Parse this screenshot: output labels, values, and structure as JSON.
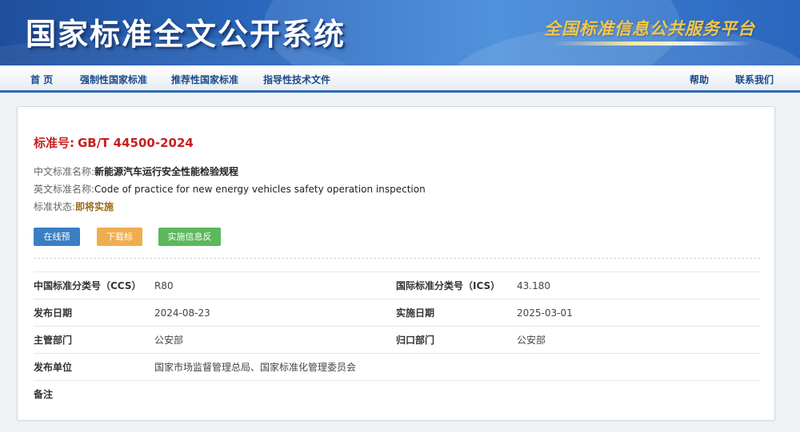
{
  "header": {
    "title": "国家标准全文公开系统",
    "slogan": "全国标准信息公共服务平台"
  },
  "nav": {
    "home": "首 页",
    "mandatory": "强制性国家标准",
    "recommended": "推荐性国家标准",
    "guidance": "指导性技术文件",
    "help": "帮助",
    "contact": "联系我们"
  },
  "standard": {
    "number_label": "标准号:",
    "number": "GB/T 44500-2024",
    "cn_name_label": "中文标准名称:",
    "cn_name": "新能源汽车运行安全性能检验规程",
    "en_name_label": "英文标准名称:",
    "en_name": "Code of practice for new energy vehicles safety operation inspection",
    "status_label": "标准状态:",
    "status": "即将实施"
  },
  "buttons": {
    "preview": "在线预览",
    "download": "下载标准",
    "feedback": "实施信息反馈"
  },
  "details": {
    "ccs_label": "中国标准分类号（CCS）",
    "ccs": "R80",
    "ics_label": "国际标准分类号（ICS）",
    "ics": "43.180",
    "publish_date_label": "发布日期",
    "publish_date": "2024-08-23",
    "impl_date_label": "实施日期",
    "impl_date": "2025-03-01",
    "authority_label": "主管部门",
    "authority": "公安部",
    "centralized_label": "归口部门",
    "centralized": "公安部",
    "publisher_label": "发布单位",
    "publisher": "国家市场监督管理总局、国家标准化管理委员会",
    "remarks_label": "备注",
    "remarks": ""
  }
}
